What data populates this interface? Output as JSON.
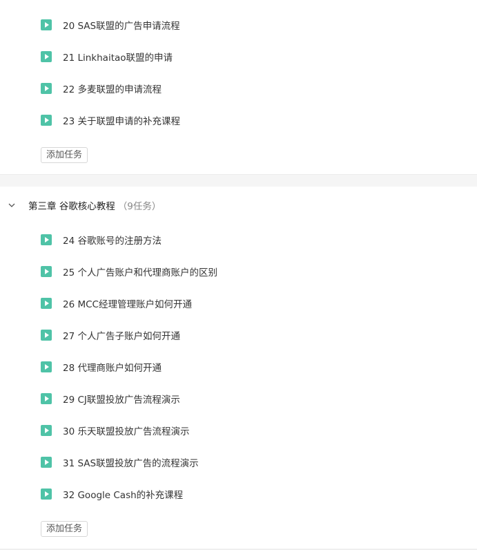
{
  "section_a": {
    "tasks": [
      {
        "label": "20 SAS联盟的广告申请流程"
      },
      {
        "label": "21 Linkhaitao联盟的申请"
      },
      {
        "label": "22 多麦联盟的申请流程"
      },
      {
        "label": "23 关于联盟申请的补充课程"
      }
    ],
    "add_task_label": "添加任务"
  },
  "chapter3": {
    "title": "第三章 谷歌核心教程",
    "count": "（9任务）",
    "tasks": [
      {
        "label": "24 谷歌账号的注册方法"
      },
      {
        "label": "25 个人广告账户和代理商账户的区别"
      },
      {
        "label": "26 MCC经理管理账户如何开通"
      },
      {
        "label": "27 个人广告子账户如何开通"
      },
      {
        "label": "28 代理商账户如何开通"
      },
      {
        "label": "29 CJ联盟投放广告流程演示"
      },
      {
        "label": "30 乐天联盟投放广告流程演示"
      },
      {
        "label": "31 SAS联盟投放广告的流程演示"
      },
      {
        "label": "32 Google Cash的补充课程"
      }
    ],
    "add_task_label": "添加任务"
  },
  "icons": {
    "task": "play-icon",
    "chapter_toggle": "chevron-down-icon"
  },
  "colors": {
    "play_icon": "#4fc3a7",
    "divider_band": "#f5f5f5"
  }
}
